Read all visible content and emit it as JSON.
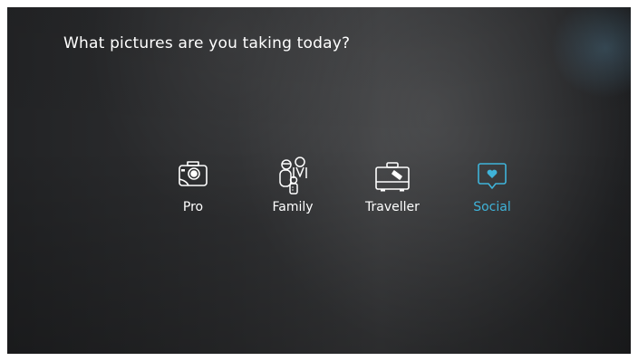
{
  "prompt": {
    "title": "What pictures are you taking today?"
  },
  "options": [
    {
      "label": "Pro",
      "icon": "camera-icon",
      "selected": false
    },
    {
      "label": "Family",
      "icon": "family-icon",
      "selected": false
    },
    {
      "label": "Traveller",
      "icon": "suitcase-icon",
      "selected": false
    },
    {
      "label": "Social",
      "icon": "heart-speech-bubble-icon",
      "selected": true
    }
  ],
  "colors": {
    "accent": "#3fb3d9",
    "text": "#ffffff",
    "background": "#2e2f31"
  }
}
